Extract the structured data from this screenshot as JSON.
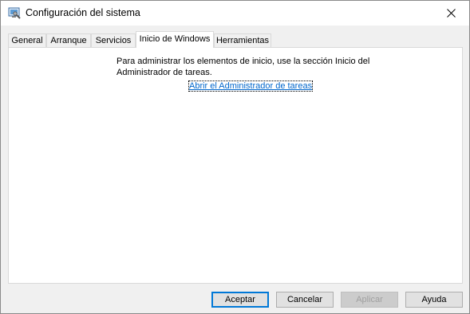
{
  "window": {
    "title": "Configuración del sistema",
    "icon": "msconfig-icon"
  },
  "tabs": [
    {
      "label": "General",
      "active": false
    },
    {
      "label": "Arranque",
      "active": false
    },
    {
      "label": "Servicios",
      "active": false
    },
    {
      "label": "Inicio de Windows",
      "active": true
    },
    {
      "label": "Herramientas",
      "active": false
    }
  ],
  "startup": {
    "info_line1": "Para administrar los elementos de inicio, use la sección Inicio del",
    "info_line2": "Administrador de tareas.",
    "link_label": "Abrir el Administrador de tareas"
  },
  "buttons": {
    "ok": "Aceptar",
    "cancel": "Cancelar",
    "apply": "Aplicar",
    "help": "Ayuda"
  },
  "colors": {
    "link": "#0066cc",
    "default_button_border": "#0078d7"
  }
}
